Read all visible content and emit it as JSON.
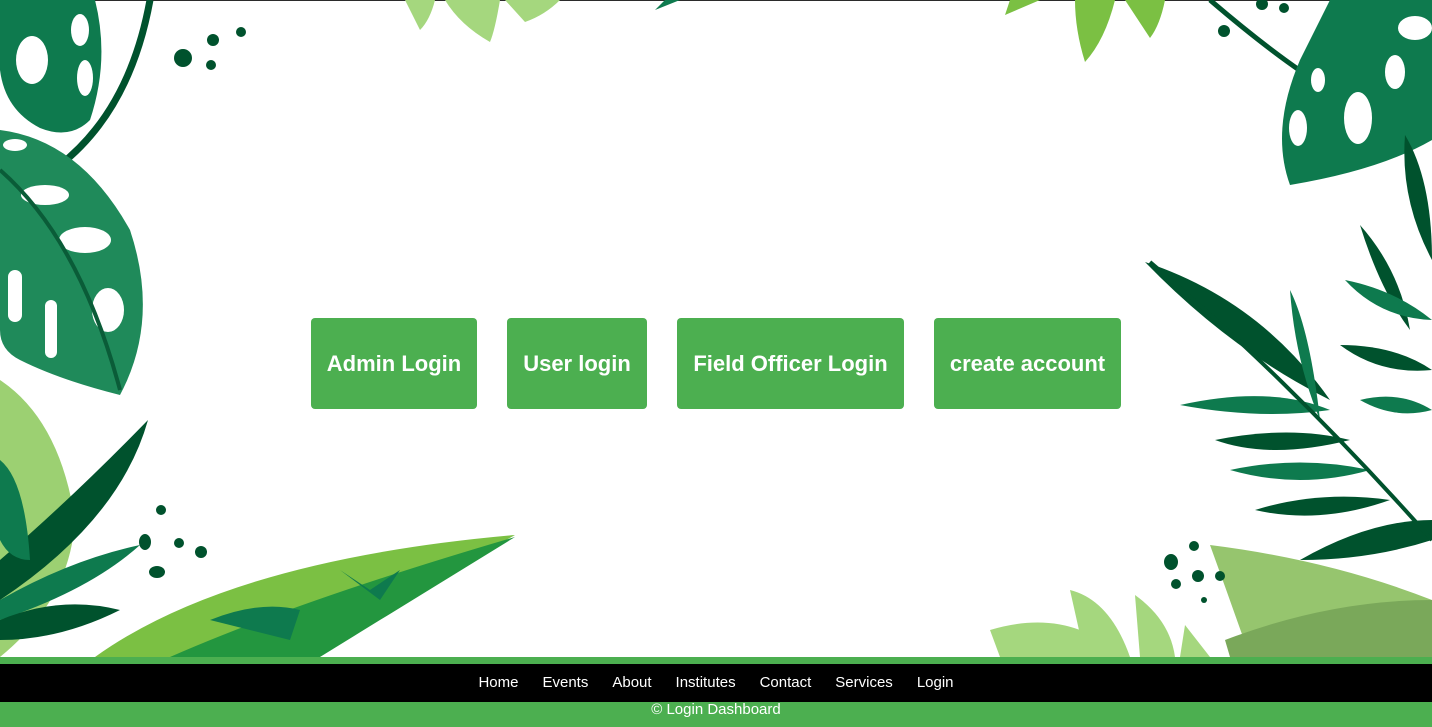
{
  "colors": {
    "accent": "#4caf50",
    "nav_background": "#000000",
    "text_on_accent": "#ffffff",
    "leaf_dark": "#00522d",
    "leaf_mid": "#0e7a4e",
    "leaf_light": "#a5d77e"
  },
  "buttons": {
    "admin_login": "Admin Login",
    "user_login": "User login",
    "field_officer_login": "Field Officer Login",
    "create_account": "create account"
  },
  "footer": {
    "nav": {
      "home": "Home",
      "events": "Events",
      "about": "About",
      "institutes": "Institutes",
      "contact": "Contact",
      "services": "Services",
      "login": "Login"
    },
    "copyright": "© Login Dashboard"
  }
}
